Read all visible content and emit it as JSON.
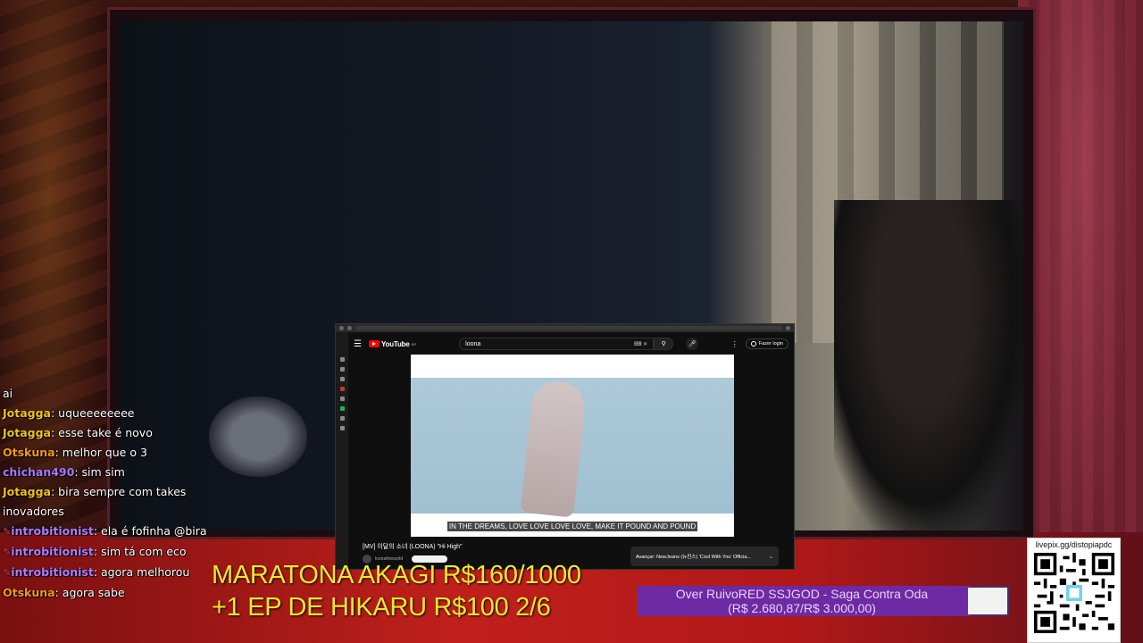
{
  "youtube": {
    "logo_text": "YouTube",
    "country_code": "BR",
    "search_query": "loona",
    "login_label": "Fazer login",
    "subtitle": "IN THE DREAMS, LOVE LOVE LOVE LOVE, MAKE IT POUND AND POUND",
    "video_title": "[MV] 이달의 소녀 (LOONA) \"Hi High\"",
    "channel_name": "loonatheworld",
    "next_label": "Avançar: NewJeans (뉴진스) 'Cool With You' Officia..."
  },
  "chat": {
    "messages": [
      {
        "user": "",
        "text": "ai"
      },
      {
        "user": "Jotagga",
        "text": "uqueeeeeeee"
      },
      {
        "user": "Jotagga",
        "text": "esse take é novo"
      },
      {
        "user": "Otskuna",
        "text": "melhor que o 3"
      },
      {
        "user": "chichan490",
        "text": "sim sim"
      },
      {
        "user": "Jotagga",
        "text": "bira sempre com takes inovadores"
      },
      {
        "user": "introbitionist",
        "text": "ela é fofinha @bira"
      },
      {
        "user": "introbitionist",
        "text": "sim tá com eco"
      },
      {
        "user": "introbitionist",
        "text": "agora melhorou"
      },
      {
        "user": "Otskuna",
        "text": "agora sabe"
      }
    ]
  },
  "goals": {
    "line1": "MARATONA AKAGI R$160/1000",
    "line2": "+1 EP DE HIKARU R$100 2/6"
  },
  "donation": {
    "title": "Over RuivoRED SSJGOD - Saga Contra Oda",
    "amount": "(R$ 2.680,87/R$ 3.000,00)",
    "progress": 0.894
  },
  "qr": {
    "label": "livepix.gg/distopiapdc"
  },
  "colors": {
    "youtube_red": "#ff0000",
    "goal_yellow": "#f5e62a",
    "donation_purple": "#6e2aa2"
  }
}
